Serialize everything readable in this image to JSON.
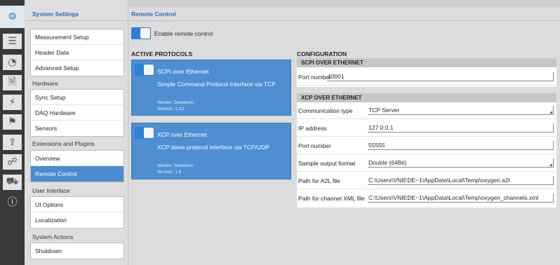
{
  "rail": {
    "icons": [
      "gear-icon",
      "list-icon",
      "gauge-icon",
      "document-icon",
      "bolt-icon",
      "flag-icon",
      "export-icon",
      "network-icon",
      "car-icon",
      "info-icon"
    ],
    "glyphs": [
      "⚙",
      "☰",
      "◔",
      "🗎",
      "⚡",
      "⚑",
      "⇪",
      "☍",
      "⛟",
      "ⓘ"
    ]
  },
  "sidebar": {
    "title": "System Settings",
    "groups": [
      {
        "category": "",
        "items": [
          "Measurement Setup",
          "Header Data",
          "Advanced Setup"
        ]
      },
      {
        "category": "Hardware",
        "items": [
          "Sync Setup",
          "DAQ Hardware",
          "Sensors"
        ]
      },
      {
        "category": "Extensions and Plugins",
        "items": [
          "Overview",
          "Remote Control"
        ]
      },
      {
        "category": "User Interface",
        "items": [
          "UI Options",
          "Localization"
        ]
      },
      {
        "category": "System Actions",
        "items": [
          "Shutdown"
        ]
      }
    ],
    "selected": "Remote Control"
  },
  "main": {
    "title": "Remote Control",
    "enable_label": "Enable remote control",
    "active_protocols_title": "ACTIVE PROTOCOLS",
    "protocols": [
      {
        "name": "SCPI over Ethernet",
        "description": "Simple Command Protocol Interface via TCP",
        "vendor": "Vendor: Dewetron",
        "version": "Version: 1.10"
      },
      {
        "name": "XCP over Ethernet",
        "description": "XCP slave protocol interface via TCP/UDP",
        "vendor": "Vendor: Dewetron",
        "version": "Version: 1.6"
      }
    ],
    "configuration_title": "CONFIGURATION",
    "scpi": {
      "header": "SCPI OVER ETHERNET",
      "port_label": "Port number",
      "port_value": "10001"
    },
    "xcp": {
      "header": "XCP OVER ETHERNET",
      "rows": [
        {
          "label": "Communication type",
          "value": "TCP Server"
        },
        {
          "label": "IP address",
          "value": "127.0.0.1"
        },
        {
          "label": "Port number",
          "value": "55555"
        },
        {
          "label": "Sample output format",
          "value": "Double (64Bit)"
        },
        {
          "label": "Path for A2L file",
          "value": "C:\\Users\\VNIEDE~1\\AppData\\Local\\Temp\\oxygen.a2l"
        },
        {
          "label": "Path for channel XML file",
          "value": "C:\\Users\\VNIEDE~1\\AppData\\Local\\Temp\\oxygen_channels.xml"
        }
      ]
    }
  },
  "colors": {
    "accent": "#2f7fd3",
    "selected": "#4a8ccf",
    "header_text": "#2b6cb6"
  }
}
